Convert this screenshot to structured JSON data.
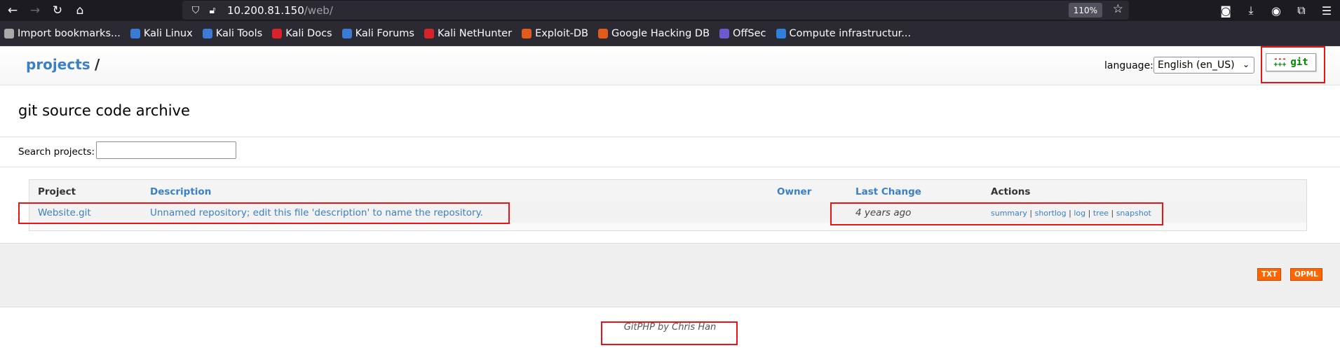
{
  "browser": {
    "url_host": "10.200.81.150",
    "url_path": "/web/",
    "zoom": "110%",
    "bookmarks": [
      {
        "label": "Import bookmarks...",
        "color": "#aaaaaa"
      },
      {
        "label": "Kali Linux",
        "color": "#3a7bd5"
      },
      {
        "label": "Kali Tools",
        "color": "#3a7bd5"
      },
      {
        "label": "Kali Docs",
        "color": "#d8232a"
      },
      {
        "label": "Kali Forums",
        "color": "#3a7bd5"
      },
      {
        "label": "Kali NetHunter",
        "color": "#d8232a"
      },
      {
        "label": "Exploit-DB",
        "color": "#e25a1c"
      },
      {
        "label": "Google Hacking DB",
        "color": "#e25a1c"
      },
      {
        "label": "OffSec",
        "color": "#6a5acd"
      },
      {
        "label": "Compute infrastructur...",
        "color": "#2f7fdd"
      }
    ]
  },
  "header": {
    "projects_link": "projects",
    "slash": "/",
    "language_label": "language:",
    "language_value": "English (en_US)",
    "git_logo_text": "git"
  },
  "main": {
    "title": "git source code archive",
    "search_label": "Search projects:",
    "columns": {
      "project": "Project",
      "description": "Description",
      "owner": "Owner",
      "last_change": "Last Change",
      "actions": "Actions"
    },
    "rows": [
      {
        "project": "Website.git",
        "description": "Unnamed repository; edit this file 'description' to name the repository.",
        "owner": "",
        "last_change": "4 years ago",
        "actions": [
          "summary",
          "shortlog",
          "log",
          "tree",
          "snapshot"
        ]
      }
    ]
  },
  "footer": {
    "txt_label": "TXT",
    "opml_label": "OPML",
    "credit": "GitPHP by Chris Han"
  },
  "colors": {
    "link": "#3b7fc4",
    "highlight": "#e8141a",
    "feed": "#ff6600"
  }
}
